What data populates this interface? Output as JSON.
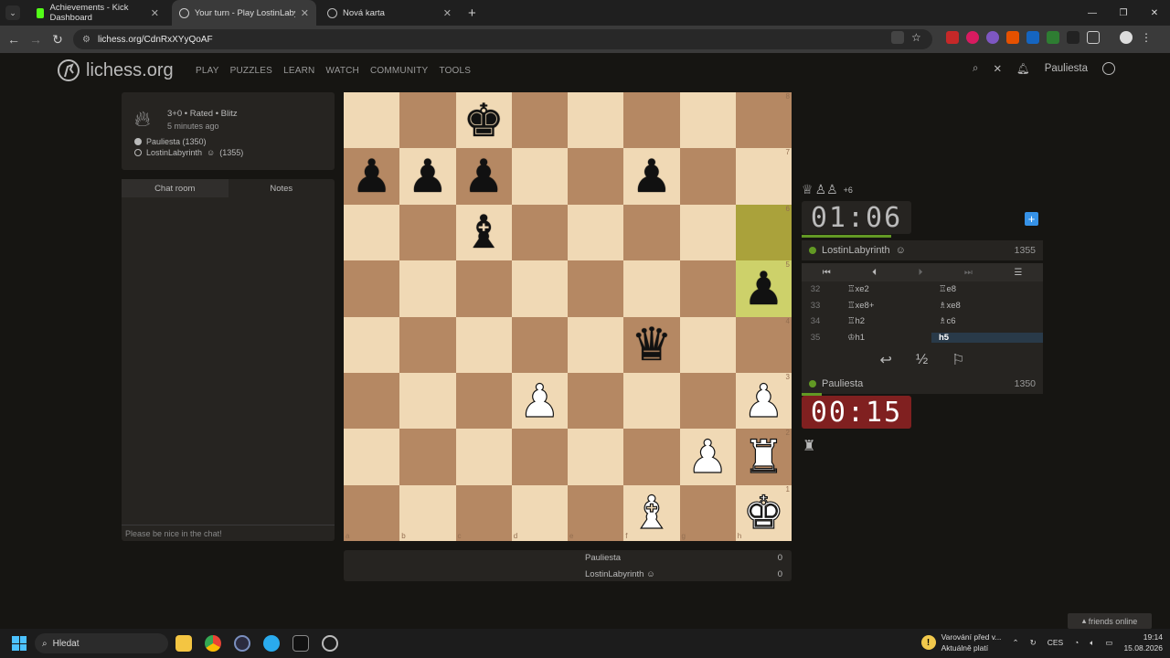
{
  "browser": {
    "tabs": [
      {
        "title": "Achievements - Kick Dashboard"
      },
      {
        "title": "Your turn - Play LostinLabyrinth"
      },
      {
        "title": "Nová karta"
      }
    ],
    "url": "lichess.org/CdnRxXYyQoAF"
  },
  "site": {
    "logo": "lichess.org",
    "nav": [
      "PLAY",
      "PUZZLES",
      "LEARN",
      "WATCH",
      "COMMUNITY",
      "TOOLS"
    ],
    "username": "Pauliesta"
  },
  "game_info": {
    "type": "3+0 • Rated • Blitz",
    "time": "5 minutes ago",
    "white": "Pauliesta (1350)",
    "black": "LostinLabyrinth",
    "black_rating": "(1355)"
  },
  "chat": {
    "tab_chat": "Chat room",
    "tab_notes": "Notes",
    "placeholder": "Please be nice in the chat!"
  },
  "board": {
    "files": [
      "a",
      "b",
      "c",
      "d",
      "e",
      "f",
      "g",
      "h"
    ],
    "ranks": [
      "8",
      "7",
      "6",
      "5",
      "4",
      "3",
      "2",
      "1"
    ],
    "rows": [
      [
        "",
        "",
        "bk",
        "",
        "",
        "",
        "",
        ""
      ],
      [
        "bp",
        "bp",
        "bp",
        "",
        "",
        "bp",
        "",
        ""
      ],
      [
        "",
        "",
        "bb",
        "",
        "",
        "",
        "",
        ""
      ],
      [
        "",
        "",
        "",
        "",
        "",
        "",
        "",
        "bp"
      ],
      [
        "",
        "",
        "",
        "",
        "",
        "bq",
        "",
        ""
      ],
      [
        "",
        "",
        "",
        "wp",
        "",
        "",
        "",
        "wp"
      ],
      [
        "",
        "",
        "",
        "",
        "",
        "",
        "wp",
        "wr"
      ],
      [
        "",
        "",
        "",
        "",
        "",
        "wb",
        "",
        "wk"
      ]
    ],
    "highlight": [
      "h6",
      "h5"
    ]
  },
  "opponent": {
    "material": "+6",
    "clock": "01:06",
    "name": "LostinLabyrinth",
    "rating": "1355"
  },
  "me": {
    "clock": "00:15",
    "name": "Pauliesta",
    "rating": "1350"
  },
  "moves": [
    {
      "n": "32",
      "w": "♖xe2",
      "b": "♖e8"
    },
    {
      "n": "33",
      "w": "♖xe8+",
      "b": "♗xe8"
    },
    {
      "n": "34",
      "w": "♖h2",
      "b": "♗c6"
    },
    {
      "n": "35",
      "w": "♔h1",
      "b": "h5"
    }
  ],
  "score": {
    "p1": "Pauliesta",
    "s1": "0",
    "p2": "LostinLabyrinth",
    "s2": "0"
  },
  "friends": "friends online",
  "taskbar": {
    "search": "Hledat",
    "warning1": "Varování před v...",
    "warning2": "Aktuálně platí",
    "lang": "CES",
    "time": "19:14",
    "date": "15.08.2026"
  },
  "colors": {
    "accent": "#629924",
    "low_time": "#802020",
    "current_move": "#293a49"
  }
}
